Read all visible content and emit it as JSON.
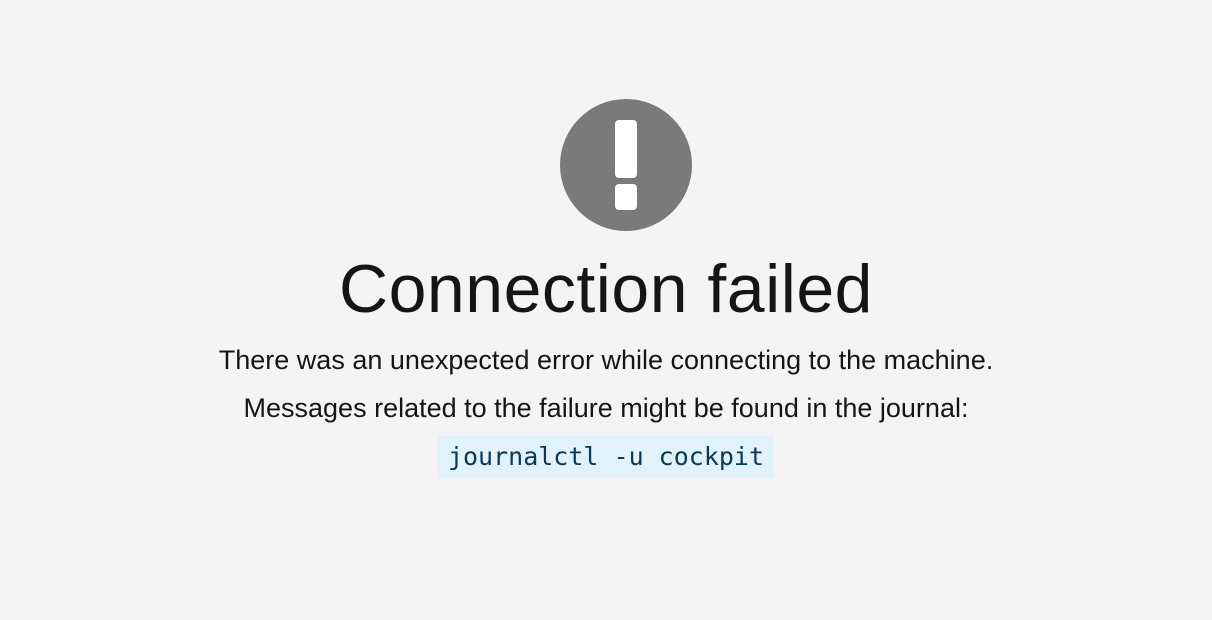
{
  "empty_state": {
    "icon": "exclamation-circle-icon",
    "title": "Connection failed",
    "message_line_1": "There was an unexpected error while connecting to the machine.",
    "message_line_2": "Messages related to the failure might be found in the journal:",
    "command": "journalctl -u cockpit"
  },
  "colors": {
    "background": "#f4f4f4",
    "icon": "#7a7a7a",
    "text": "#151515",
    "code_background": "#e2f2fb",
    "code_text": "#0b3954"
  }
}
